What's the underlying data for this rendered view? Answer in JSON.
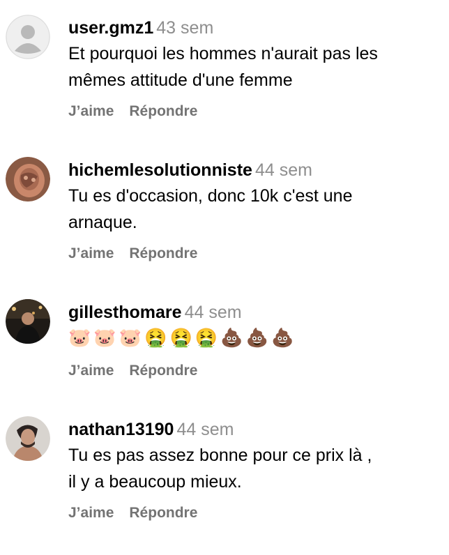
{
  "comments": [
    {
      "username": "user.gmz1",
      "time": "43 sem",
      "text": "Et pourquoi les hommes n'aurait pas les\nmêmes attitude d'une femme",
      "like_label": "J’aime",
      "reply_label": "Répondre",
      "avatar": "default-avatar-icon"
    },
    {
      "username": "hichemlesolutionniste",
      "time": "44 sem",
      "text": "Tu es d'occasion, donc 10k c'est une\narnaque.",
      "like_label": "J’aime",
      "reply_label": "Répondre",
      "avatar": "profile-photo"
    },
    {
      "username": "gillesthomare",
      "time": "44 sem",
      "text": "🐷🐷🐷🤮🤮🤮💩💩💩",
      "like_label": "J’aime",
      "reply_label": "Répondre",
      "avatar": "profile-photo"
    },
    {
      "username": "nathan13190",
      "time": "44 sem",
      "text": "Tu es pas assez bonne pour ce prix là ,\nil y a beaucoup mieux.",
      "like_label": "J’aime",
      "reply_label": "Répondre",
      "avatar": "profile-photo"
    }
  ],
  "colors": {
    "username": "#000000",
    "timestamp": "#8e8e8e",
    "action": "#737373"
  }
}
